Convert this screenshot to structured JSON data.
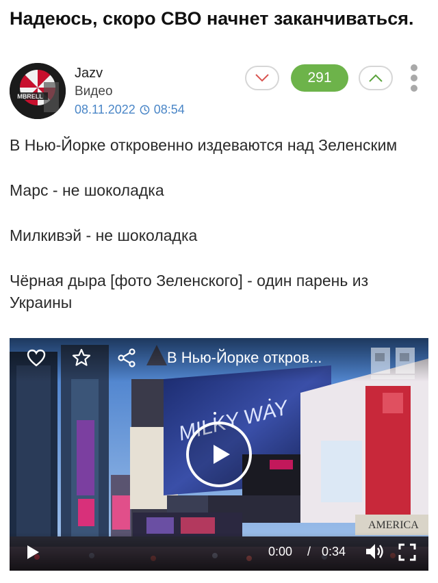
{
  "post": {
    "title": "Надеюсь, скоро СВО начнет заканчиваться.",
    "author": "Jazv",
    "type": "Видео",
    "date": "08.11.2022",
    "time": "08:54",
    "rating": "291",
    "avatar_text": "MBRELL"
  },
  "body": [
    "В Нью-Йорке откровенно издеваются над Зеленским",
    "Марс - не шоколадка",
    "Милкивэй - не шоколадка",
    "Чёрная дыра [фото Зеленского] - один парень из Украины"
  ],
  "video": {
    "title": "В Нью-Йорке откров...",
    "current_time": "0:00",
    "separator": "/",
    "duration": "0:34",
    "billboard_text": "MILKY WAY",
    "sign_text": "AMERICA"
  },
  "icons": {
    "vote_down": "chevron-down-icon",
    "vote_up": "chevron-up-icon",
    "more": "more-vertical-icon",
    "clock": "clock-icon",
    "like": "heart-icon",
    "favorite": "star-icon",
    "share": "share-icon",
    "play": "play-icon",
    "volume": "volume-icon",
    "fullscreen": "fullscreen-icon"
  },
  "colors": {
    "rating_bg": "#6db34a",
    "date": "#4a86c7",
    "vote_down": "#d9534f",
    "vote_up": "#5aa33c"
  }
}
